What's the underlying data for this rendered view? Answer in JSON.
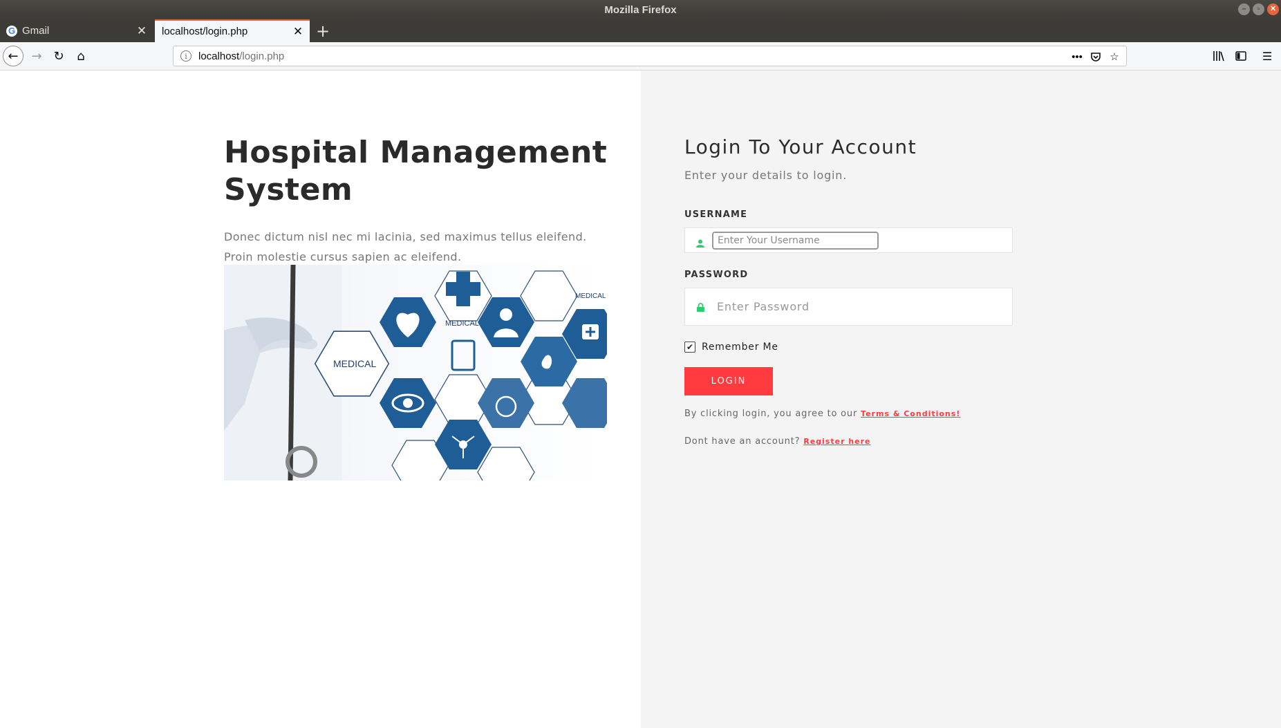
{
  "window": {
    "title": "Mozilla Firefox"
  },
  "tabs": [
    {
      "label": "Gmail",
      "favicon": "google-favicon"
    },
    {
      "label": "localhost/login.php"
    }
  ],
  "navbar": {
    "url_host": "localhost",
    "url_path": "/login.php"
  },
  "left": {
    "title": "Hospital Management System",
    "description": "Donec dictum nisl nec mi lacinia, sed maximus tellus eleifend. Proin molestie cursus sapien ac eleifend.",
    "image_labels": {
      "medical_left": "MEDICAL",
      "medical_top": "MEDICAL",
      "medical_right": "MEDICAL"
    }
  },
  "login": {
    "title": "Login To Your Account",
    "subtitle": "Enter your details to login.",
    "username_label": "USERNAME",
    "username_placeholder": "Enter Your Username",
    "password_label": "PASSWORD",
    "password_placeholder": "Enter Password",
    "remember_label": "Remember Me",
    "remember_checked": true,
    "button_label": "LOGIN",
    "terms_text": "By clicking login, you agree to our",
    "terms_link": "Terms & Conditions!",
    "register_text": "Dont have an account?",
    "register_link": "Register here"
  },
  "colors": {
    "accent": "#ff3b3f",
    "icon_green": "#2ecc71",
    "hex_blue": "#1f5d96",
    "right_panel_bg": "#f4f4f4"
  }
}
